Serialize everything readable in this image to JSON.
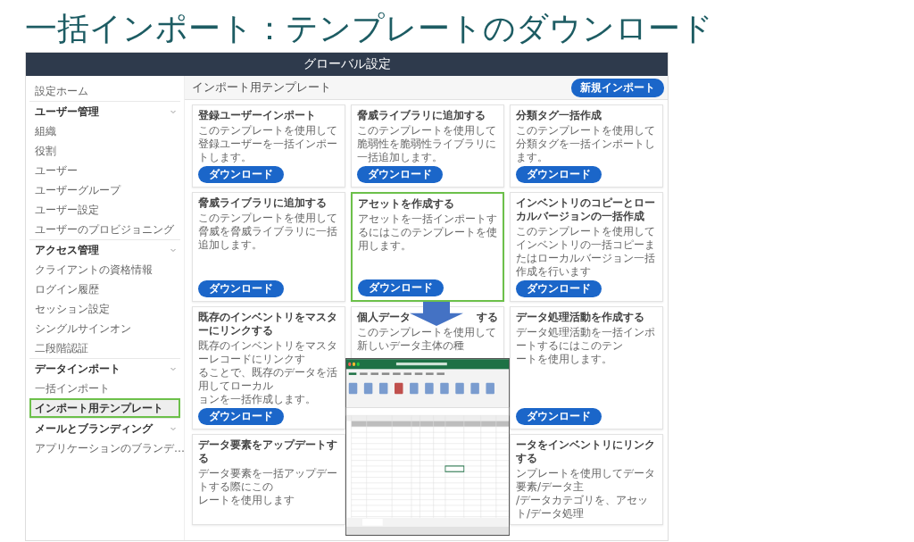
{
  "slide_title": "一括インポート：テンプレートのダウンロード",
  "app": {
    "header_title": "グローバル設定",
    "sidebar": [
      {
        "kind": "link",
        "label": "設定ホーム",
        "selected": false,
        "highlighted": false
      },
      {
        "kind": "section",
        "label": "ユーザー管理",
        "expanded": true,
        "children": [
          {
            "kind": "link",
            "label": "組織",
            "selected": false,
            "highlighted": false
          },
          {
            "kind": "link",
            "label": "役割",
            "selected": false,
            "highlighted": false
          },
          {
            "kind": "link",
            "label": "ユーザー",
            "selected": false,
            "highlighted": false
          },
          {
            "kind": "link",
            "label": "ユーザーグループ",
            "selected": false,
            "highlighted": false
          },
          {
            "kind": "link",
            "label": "ユーザー設定",
            "selected": false,
            "highlighted": false
          },
          {
            "kind": "link",
            "label": "ユーザーのプロビジョニング",
            "selected": false,
            "highlighted": false
          }
        ]
      },
      {
        "kind": "section",
        "label": "アクセス管理",
        "expanded": true,
        "children": [
          {
            "kind": "link",
            "label": "クライアントの資格情報",
            "selected": false,
            "highlighted": false
          },
          {
            "kind": "link",
            "label": "ログイン履歴",
            "selected": false,
            "highlighted": false
          },
          {
            "kind": "link",
            "label": "セッション設定",
            "selected": false,
            "highlighted": false
          },
          {
            "kind": "link",
            "label": "シングルサインオン",
            "selected": false,
            "highlighted": false
          },
          {
            "kind": "link",
            "label": "二段階認証",
            "selected": false,
            "highlighted": false
          }
        ]
      },
      {
        "kind": "section",
        "label": "データインポート",
        "expanded": true,
        "children": [
          {
            "kind": "link",
            "label": "一括インポート",
            "selected": false,
            "highlighted": false
          },
          {
            "kind": "link",
            "label": "インポート用テンプレート",
            "selected": true,
            "highlighted": true
          }
        ]
      },
      {
        "kind": "section",
        "label": "メールとブランディング",
        "expanded": true,
        "children": [
          {
            "kind": "link",
            "label": "アプリケーションのブランデ…",
            "selected": false,
            "highlighted": false
          }
        ]
      }
    ],
    "page_title": "インポート用テンプレート",
    "new_import_button": "新規インポート",
    "cards": [
      {
        "kind": "full",
        "title": "登録ユーザーインポート",
        "description": "このテンプレートを使用して登録ユーザーを一括インポートします。",
        "button": "ダウンロード",
        "highlighted": false
      },
      {
        "kind": "full",
        "title": "脅威ライブラリに追加する",
        "description": "このテンプレートを使用して脆弱性を脆弱性ライブラリに一括追加します。",
        "button": "ダウンロード",
        "highlighted": false
      },
      {
        "kind": "full",
        "title": "分類タグ一括作成",
        "description": "このテンプレートを使用して分類タグを一括インポートします。",
        "button": "ダウンロード",
        "highlighted": false
      },
      {
        "kind": "full",
        "title": "脅威ライブラリに追加する",
        "description": "このテンプレートを使用して脅威を脅威ライブラリに一括追加します。",
        "button": "ダウンロード",
        "highlighted": false
      },
      {
        "kind": "full",
        "title": "アセットを作成する",
        "description": "アセットを一括インポートするにはこのテンプレートを使用します。",
        "button": "ダウンロード",
        "highlighted": true
      },
      {
        "kind": "full",
        "title": "インベントリのコピーとローカルバージョンの一括作成",
        "description": "このテンプレートを使用してインベントリの一括コピーまたはローカルバージョン一括作成を行います",
        "button": "ダウンロード",
        "highlighted": false
      },
      {
        "kind": "lines",
        "title": "既存のインベントリをマスターにリンクする",
        "lines": [
          "既存のインベントリをマスターレコードにリンクす",
          "ることで、既存のデータを活用してローカル",
          "ョンを一括作成します。"
        ],
        "button": "ダウンロード",
        "highlighted": false
      },
      {
        "kind": "covered",
        "title_parts": [
          "個人データ",
          "する"
        ],
        "lines": [
          "このテンプレートを使用して新しいデータ主体の種"
        ]
      },
      {
        "kind": "lines",
        "title": "データ処理活動を作成する",
        "lines": [
          "データ処理活動を一括インポートするにはこのテン",
          "ートを使用します。"
        ],
        "button": "ダウンロード",
        "highlighted": false
      },
      {
        "kind": "lines",
        "title": "データ要素をアップデートする",
        "lines": [
          "データ要素を一括アップデートする際にこの",
          "レートを使用します"
        ],
        "highlighted": false
      },
      {
        "kind": "empty"
      },
      {
        "kind": "lines",
        "title": "ータをインベントリにリンクする",
        "lines": [
          "ンプレートを使用してデータ要素/データ主",
          "/データカテゴリを、アセット/データ処理"
        ],
        "highlighted": false
      }
    ]
  }
}
